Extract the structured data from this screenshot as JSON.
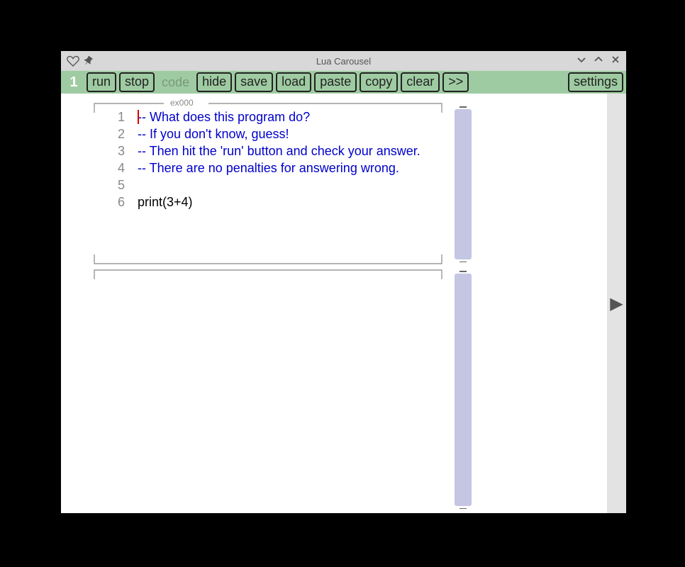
{
  "window": {
    "title": "Lua Carousel"
  },
  "toolbar": {
    "tab_number": "1",
    "run": "run",
    "stop": "stop",
    "code_label": "code",
    "hide": "hide",
    "save": "save",
    "load": "load",
    "paste": "paste",
    "copy": "copy",
    "clear": "clear",
    "next": ">>",
    "settings": "settings"
  },
  "editor": {
    "label": "ex000",
    "lines": [
      {
        "num": "1",
        "text": "-- What does this program do?",
        "type": "comment"
      },
      {
        "num": "2",
        "text": "-- If you don't know, guess!",
        "type": "comment"
      },
      {
        "num": "3",
        "text": "-- Then hit the 'run' button and check your answer.",
        "type": "comment"
      },
      {
        "num": "4",
        "text": "-- There are no penalties for answering wrong.",
        "type": "comment"
      },
      {
        "num": "5",
        "text": "",
        "type": "code"
      },
      {
        "num": "6",
        "text": "print(3+4)",
        "type": "code"
      }
    ]
  },
  "nav": {
    "right_arrow": "▶"
  }
}
